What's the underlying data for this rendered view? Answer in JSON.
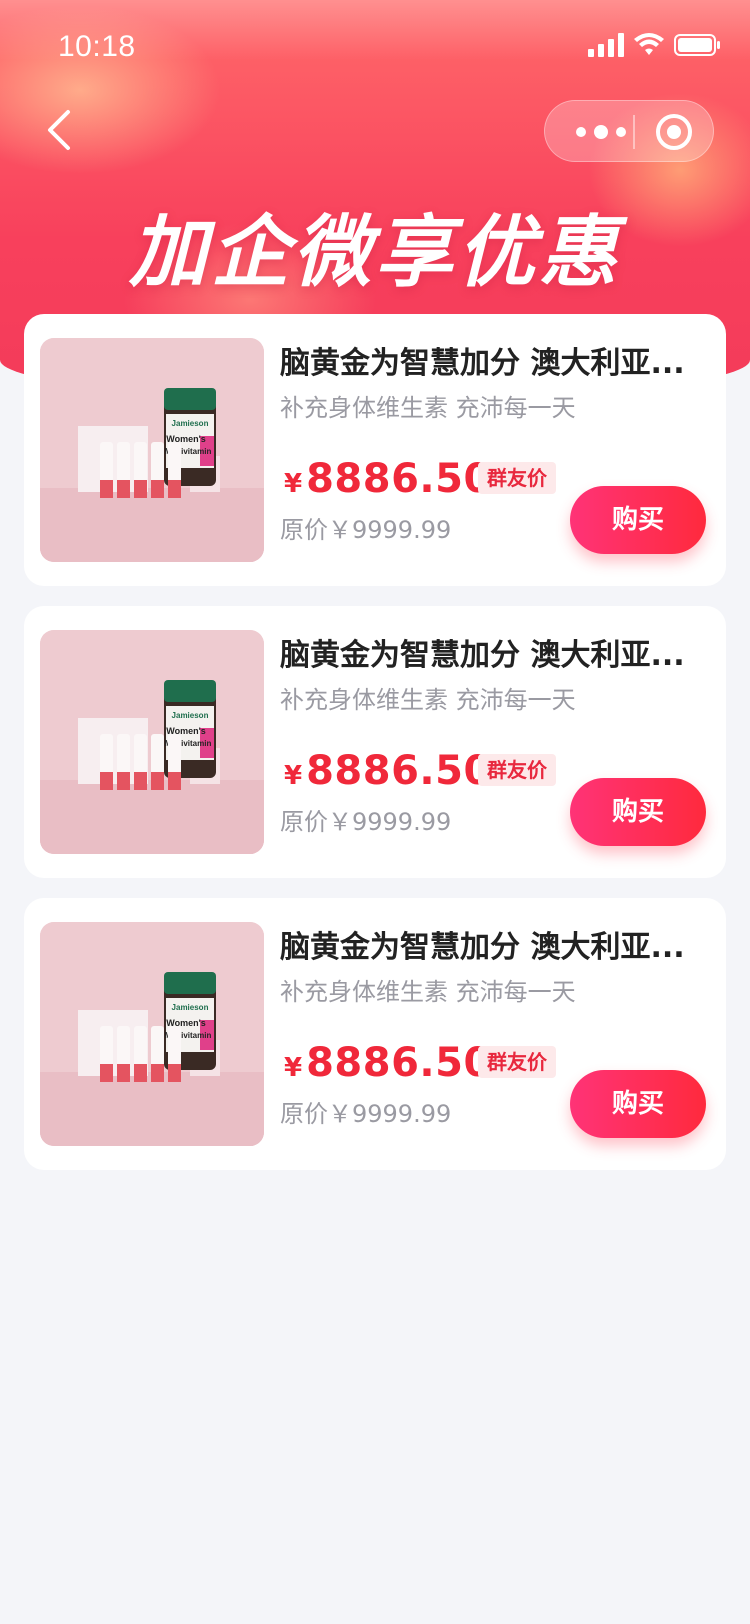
{
  "status_bar": {
    "time": "10:18"
  },
  "header": {
    "title": "加企微享优惠"
  },
  "colors": {
    "accent": "#f0283a",
    "hero": "#f8405c",
    "button": "#ff3377",
    "background": "#f4f5f9"
  },
  "icons": {
    "back": "chevron-left-icon",
    "more": "more-dots-icon",
    "close": "target-icon",
    "signal": "signal-icon",
    "wifi": "wifi-icon",
    "battery": "battery-icon"
  },
  "products": [
    {
      "name": "脑黄金为智慧加分 澳大利亚...",
      "subtitle": "补充身体维生素 充沛每一天",
      "currency": "¥",
      "price": "8886.50",
      "badge": "群友价",
      "original_price": "原价￥9999.99",
      "buy_label": "购买",
      "image_text": {
        "brand": "Jamieson",
        "line1": "Women's",
        "line2": "Multivitamin"
      }
    },
    {
      "name": "脑黄金为智慧加分 澳大利亚...",
      "subtitle": "补充身体维生素 充沛每一天",
      "currency": "¥",
      "price": "8886.50",
      "badge": "群友价",
      "original_price": "原价￥9999.99",
      "buy_label": "购买",
      "image_text": {
        "brand": "Jamieson",
        "line1": "Women's",
        "line2": "Multivitamin"
      }
    },
    {
      "name": "脑黄金为智慧加分 澳大利亚...",
      "subtitle": "补充身体维生素 充沛每一天",
      "currency": "¥",
      "price": "8886.50",
      "badge": "群友价",
      "original_price": "原价￥9999.99",
      "buy_label": "购买",
      "image_text": {
        "brand": "Jamieson",
        "line1": "Women's",
        "line2": "Multivitamin"
      }
    }
  ]
}
